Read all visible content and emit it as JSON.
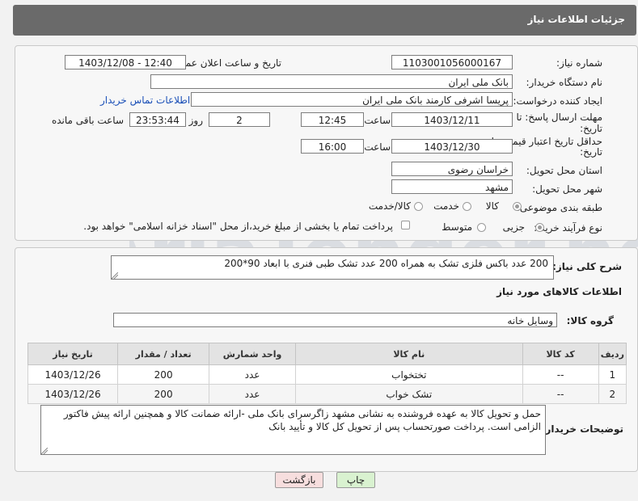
{
  "header": {
    "title": "جزئیات اطلاعات نیاز"
  },
  "form": {
    "need_number_label": "شماره نیاز:",
    "need_number": "1103001056000167",
    "announce_label": "تاریخ و ساعت اعلان عمومی:",
    "announce_value": "1403/12/08 - 12:40",
    "buyer_org_label": "نام دستگاه خریدار:",
    "buyer_org": "بانک ملی ایران",
    "creator_label": "ایجاد کننده درخواست:",
    "creator": "پریسا اشرفی کارمند بانک ملی ایران",
    "contact_link": "اطلاعات تماس خریدار",
    "deadline_label_1": "مهلت ارسال پاسخ: تا",
    "deadline_label_2": "تاریخ:",
    "deadline_date": "1403/12/11",
    "time_word": "ساعت",
    "deadline_time": "12:45",
    "days_value": "2",
    "days_and": "روز و",
    "remaining_time": "23:53:44",
    "remaining_label": "ساعت باقی مانده",
    "price_label_1": "حداقل تاریخ اعتبار قیمت: تا",
    "price_label_2": "تاریخ:",
    "price_date": "1403/12/30",
    "price_time": "16:00",
    "province_label": "استان محل تحویل:",
    "province": "خراسان رضوی",
    "city_label": "شهر محل تحویل:",
    "city": "مشهد",
    "category_label": "طبقه بندی موضوعی:",
    "category_options": [
      "کالا",
      "خدمت",
      "کالا/خدمت"
    ],
    "process_label": "نوع فرآیند خرید :",
    "process_options": [
      "جزیی",
      "متوسط"
    ],
    "payment_note": "پرداخت تمام یا بخشی از مبلغ خرید،از محل \"اسناد خزانه اسلامی\" خواهد بود."
  },
  "description": {
    "label": "شرح کلی نیاز:",
    "text": "200 عدد باکس فلزی تشک به همراه 200 عدد تشک طبی فنری با ابعاد 90*200"
  },
  "goods": {
    "section_title": "اطلاعات کالاهای مورد نیاز",
    "group_label": "گروه کالا:",
    "group_value": "وسایل خانه",
    "columns": [
      "ردیف",
      "کد کالا",
      "نام کالا",
      "واحد شمارش",
      "تعداد / مقدار",
      "تاریخ نیاز"
    ],
    "rows": [
      [
        "1",
        "--",
        "تختخواب",
        "عدد",
        "200",
        "1403/12/26"
      ],
      [
        "2",
        "--",
        "تشک خواب",
        "عدد",
        "200",
        "1403/12/26"
      ]
    ]
  },
  "buyer_notes": {
    "label": "توضیحات خریدار:",
    "text": "حمل و تحویل کالا به عهده فروشنده به نشانی مشهد زاگرسرای بانک ملی -ارائه ضمانت کالا و همچنین ارائه پیش فاکتور الزامی است. پرداخت صورتحساب پس از تحویل کل کالا و تأیید بانک"
  },
  "buttons": {
    "print": "چاپ",
    "back": "بازگشت"
  },
  "colors": {
    "header_bg": "#6a6a6a",
    "link": "#1a4fb7",
    "print_btn": "#d9f2d0",
    "back_btn": "#f7dede"
  }
}
